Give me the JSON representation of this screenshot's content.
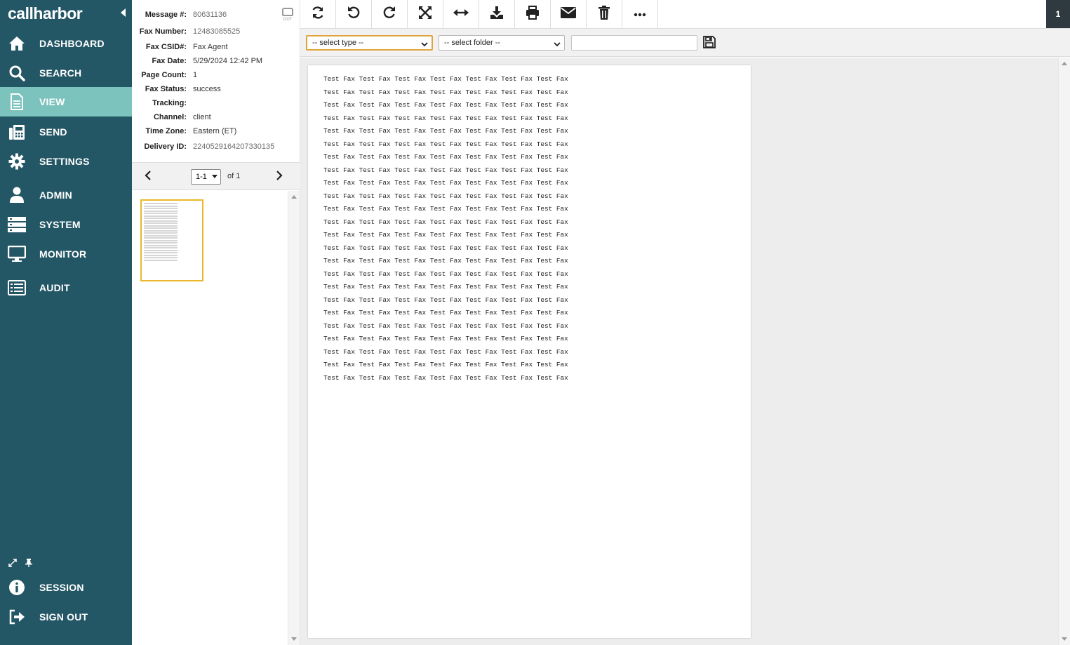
{
  "sidebar": {
    "brand": "callharbor",
    "items": [
      {
        "label": "DASHBOARD",
        "icon": "home-icon"
      },
      {
        "label": "SEARCH",
        "icon": "search-icon"
      },
      {
        "label": "VIEW",
        "icon": "document-icon",
        "active": true
      },
      {
        "label": "SEND",
        "icon": "fax-machine-icon"
      },
      {
        "label": "SETTINGS",
        "icon": "gear-icon"
      },
      {
        "label": "ADMIN",
        "icon": "user-icon"
      },
      {
        "label": "SYSTEM",
        "icon": "server-icon"
      },
      {
        "label": "MONITOR",
        "icon": "monitor-icon"
      },
      {
        "label": "AUDIT",
        "icon": "list-icon"
      }
    ],
    "footer_items": [
      {
        "label": "SESSION",
        "icon": "info-icon"
      },
      {
        "label": "SIGN OUT",
        "icon": "sign-out-icon"
      }
    ],
    "colors": {
      "background": "#245766",
      "active": "#7cc3bd"
    }
  },
  "info": {
    "message_label": "Message #:",
    "message_value": "80631136",
    "fax_number_label": "Fax Number:",
    "fax_number_value": "12483085525",
    "csid_label": "Fax CSID#:",
    "csid_value": "Fax Agent",
    "date_label": "Fax Date:",
    "date_value": "5/29/2024 12:42 PM",
    "page_count_label": "Page Count:",
    "page_count_value": "1",
    "status_label": "Fax Status:",
    "status_value": "success",
    "tracking_label": "Tracking:",
    "tracking_value": "",
    "channel_label": "Channel:",
    "channel_value": "client",
    "timezone_label": "Time Zone:",
    "timezone_value": "Eastern (ET)",
    "delivery_label": "Delivery ID:",
    "delivery_value": "2240529164207330135",
    "direction_badge": "OUT"
  },
  "pager": {
    "selected": "1-1",
    "of_label": "of 1"
  },
  "toolbar": {
    "tools": [
      "refresh-icon",
      "rotate-left-icon",
      "rotate-right-icon",
      "fit-page-icon",
      "fit-width-icon",
      "download-icon",
      "print-icon",
      "email-icon",
      "trash-icon",
      "more-icon"
    ],
    "counter": "1"
  },
  "filters": {
    "type_placeholder": "-- select type --",
    "folder_placeholder": "-- select folder --",
    "tag_value": ""
  },
  "document": {
    "line_text": "Test Fax Test Fax Test Fax Test Fax Test Fax Test Fax Test Fax",
    "line_count": 24
  }
}
